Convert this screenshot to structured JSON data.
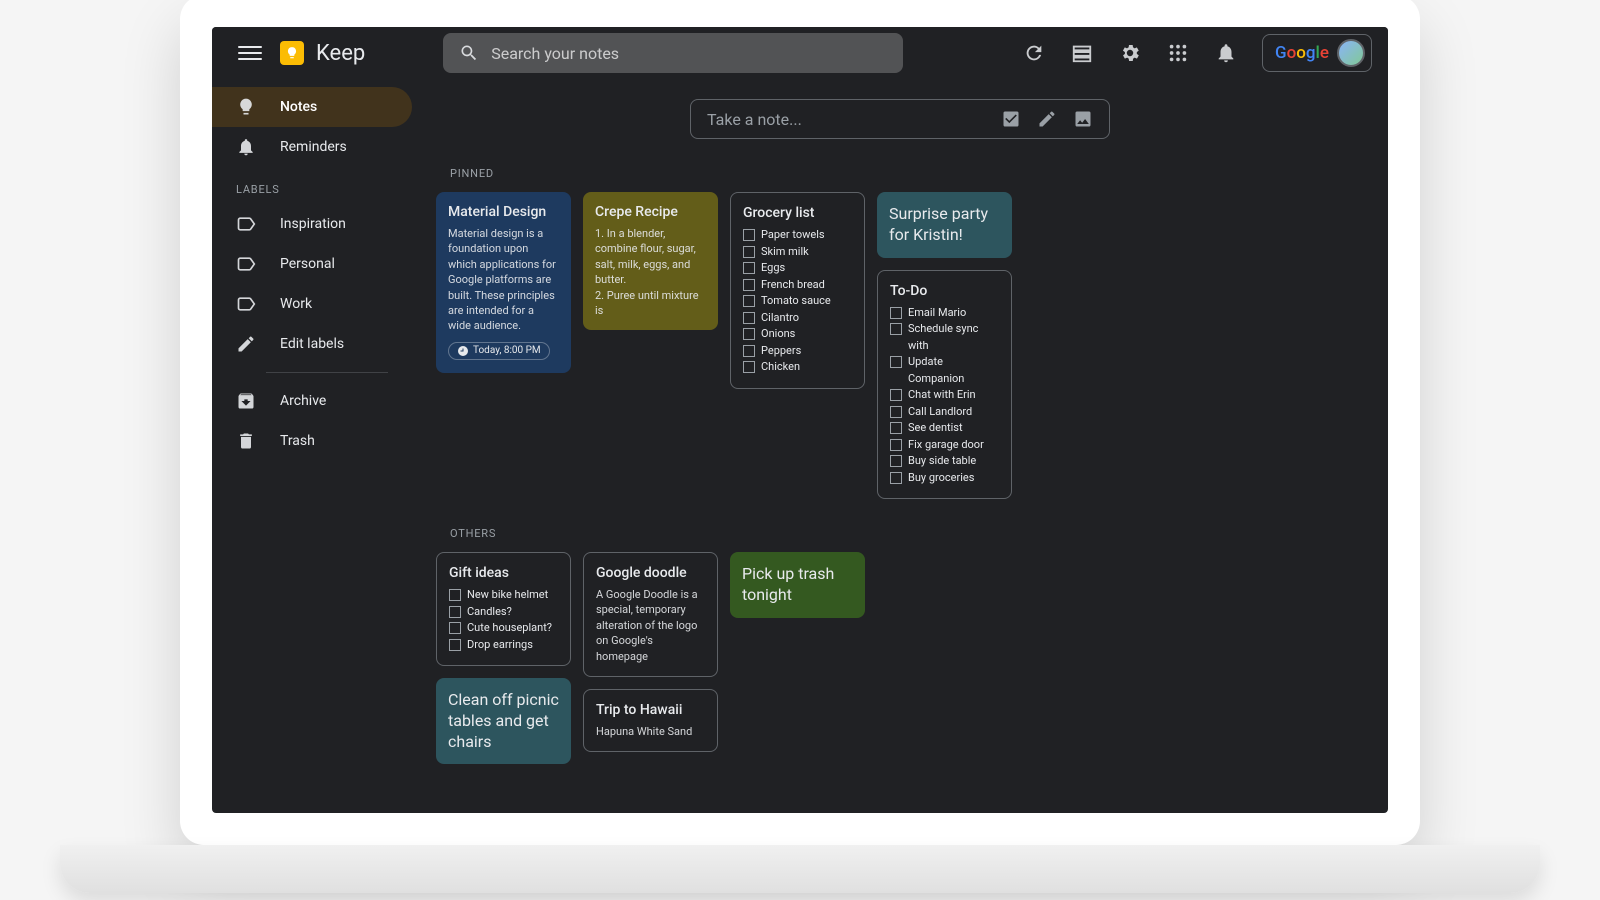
{
  "header": {
    "app_title": "Keep",
    "search_placeholder": "Search your notes"
  },
  "sidebar": {
    "notes": "Notes",
    "reminders": "Reminders",
    "labels_header": "Labels",
    "labels": [
      "Inspiration",
      "Personal",
      "Work"
    ],
    "edit_labels": "Edit labels",
    "archive": "Archive",
    "trash": "Trash"
  },
  "take_note": {
    "placeholder": "Take a note..."
  },
  "sections": {
    "pinned": "Pinned",
    "others": "Others"
  },
  "notes": {
    "material": {
      "title": "Material Design",
      "body": "Material design is a foundation upon which applications for Google platforms are built. These principles are intended for a wide audience.",
      "reminder": "Today, 8:00 PM"
    },
    "crepe": {
      "title": "Crepe Recipe",
      "body": "1. In a blender, combine flour, sugar, salt, milk, eggs, and butter.\n2. Puree until mixture is"
    },
    "grocery": {
      "title": "Grocery list",
      "items": [
        "Paper towels",
        "Skim milk",
        "Eggs",
        "French bread",
        "Tomato sauce",
        "Cilantro",
        "Onions",
        "Peppers",
        "Chicken"
      ]
    },
    "surprise": {
      "title": "Surprise party for Kristin!"
    },
    "todo": {
      "title": "To-Do",
      "items": [
        "Email Mario",
        "Schedule sync with",
        "Update Companion",
        "Chat with Erin",
        "Call Landlord",
        "See dentist",
        "Fix garage door",
        "Buy side table",
        "Buy groceries"
      ]
    },
    "gift": {
      "title": "Gift ideas",
      "items": [
        "New bike helmet",
        "Candles?",
        "Cute houseplant?",
        "Drop earrings"
      ]
    },
    "doodle": {
      "title": "Google doodle",
      "body": "A Google Doodle is a special, temporary alteration of the logo on Google's homepage"
    },
    "trash": {
      "title": "Pick up trash tonight"
    },
    "picnic": {
      "title": "Clean off picnic tables and get chairs"
    },
    "hawaii": {
      "title": "Trip to Hawaii",
      "body": "Hapuna White Sand"
    }
  }
}
